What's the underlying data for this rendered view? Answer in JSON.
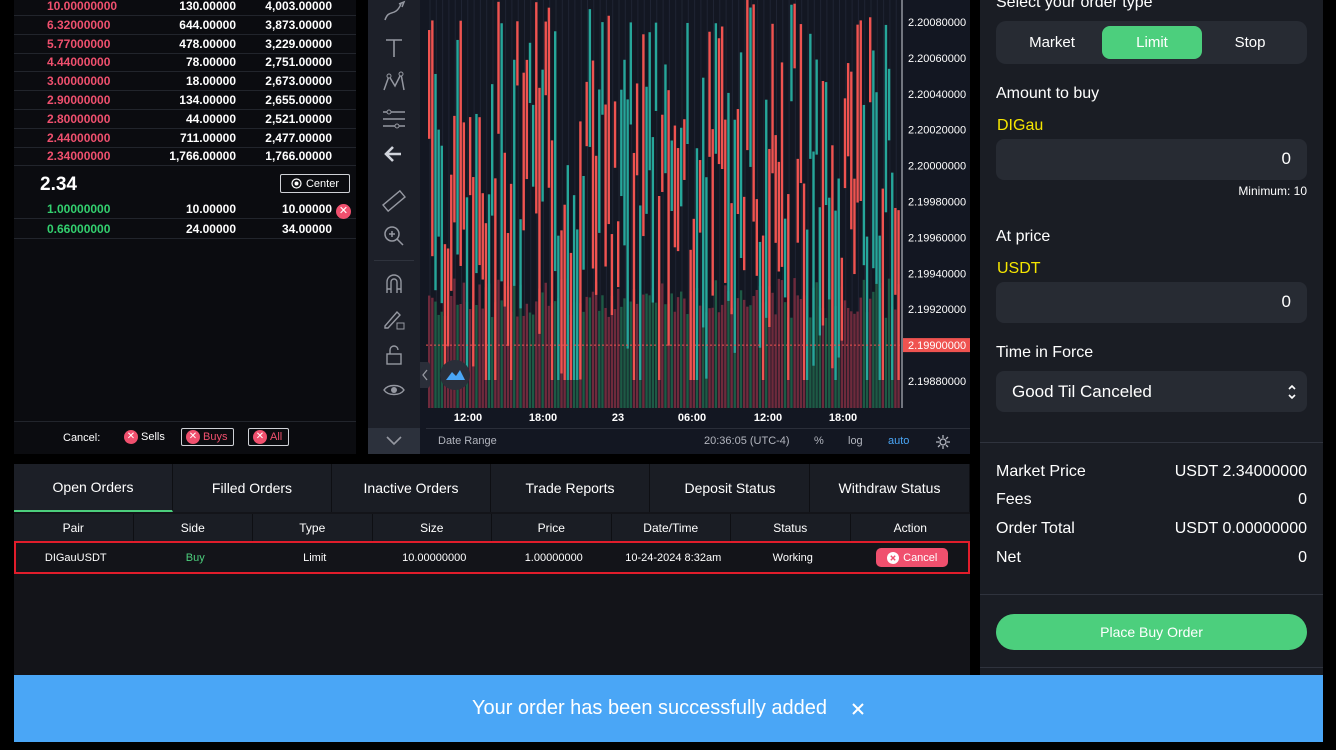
{
  "orderbook": {
    "asks": [
      {
        "price": "10.00000000",
        "size": "130.00000",
        "total": "4,003.00000"
      },
      {
        "price": "6.32000000",
        "size": "644.00000",
        "total": "3,873.00000"
      },
      {
        "price": "5.77000000",
        "size": "478.00000",
        "total": "3,229.00000"
      },
      {
        "price": "4.44000000",
        "size": "78.00000",
        "total": "2,751.00000"
      },
      {
        "price": "3.00000000",
        "size": "18.00000",
        "total": "2,673.00000"
      },
      {
        "price": "2.90000000",
        "size": "134.00000",
        "total": "2,655.00000"
      },
      {
        "price": "2.80000000",
        "size": "44.00000",
        "total": "2,521.00000"
      },
      {
        "price": "2.44000000",
        "size": "711.00000",
        "total": "2,477.00000"
      },
      {
        "price": "2.34000000",
        "size": "1,766.00000",
        "total": "1,766.00000"
      }
    ],
    "mid_price": "2.34",
    "center_label": "Center",
    "bids": [
      {
        "price": "1.00000000",
        "size": "10.00000",
        "total": "10.00000"
      },
      {
        "price": "0.66000000",
        "size": "24.00000",
        "total": "34.00000"
      }
    ],
    "cancel_label": "Cancel:",
    "cancel_sells": "Sells",
    "cancel_buys": "Buys",
    "cancel_all": "All"
  },
  "chart": {
    "price_ticks": [
      "2.20080000",
      "2.20060000",
      "2.20040000",
      "2.20020000",
      "2.20000000",
      "2.19980000",
      "2.19960000",
      "2.19940000",
      "2.19920000",
      "2.19900000",
      "2.19880000"
    ],
    "current_price": "2.19900000",
    "time_ticks": [
      "12:00",
      "18:00",
      "23",
      "06:00",
      "12:00",
      "18:00"
    ],
    "date_range": "Date Range",
    "clock": "20:36:05 (UTC-4)",
    "pct": "%",
    "log": "log",
    "auto": "auto"
  },
  "order_form": {
    "order_type_title": "Select your order type",
    "types": [
      "Market",
      "Limit",
      "Stop"
    ],
    "active_type": "Limit",
    "amount_label": "Amount to buy",
    "amount_currency": "DIGau",
    "amount_value": "0",
    "minimum": "Minimum: 10",
    "price_label": "At price",
    "price_currency": "USDT",
    "price_value": "0",
    "tif_label": "Time in Force",
    "tif_value": "Good Til Canceled",
    "market_price_label": "Market Price",
    "market_price_value": "USDT 2.34000000",
    "fees_label": "Fees",
    "fees_value": "0",
    "order_total_label": "Order Total",
    "order_total_value": "USDT 0.00000000",
    "net_label": "Net",
    "net_value": "0",
    "place_button": "Place Buy Order"
  },
  "orders": {
    "tabs": [
      "Open Orders",
      "Filled Orders",
      "Inactive Orders",
      "Trade Reports",
      "Deposit Status",
      "Withdraw Status"
    ],
    "columns": [
      "Pair",
      "Side",
      "Type",
      "Size",
      "Price",
      "Date/Time",
      "Status",
      "Action"
    ],
    "row": {
      "pair": "DIGauUSDT",
      "side": "Buy",
      "type": "Limit",
      "size": "10.00000000",
      "price": "1.00000000",
      "datetime": "10-24-2024 8:32am",
      "status": "Working",
      "action": "Cancel"
    }
  },
  "toast": {
    "message": "Your order has been successfully added"
  },
  "colors": {
    "accent_green": "#4ccf7d",
    "ask_red": "#f0506e",
    "toast_blue": "#4aa6f6",
    "currency_yellow": "#f6e600"
  }
}
